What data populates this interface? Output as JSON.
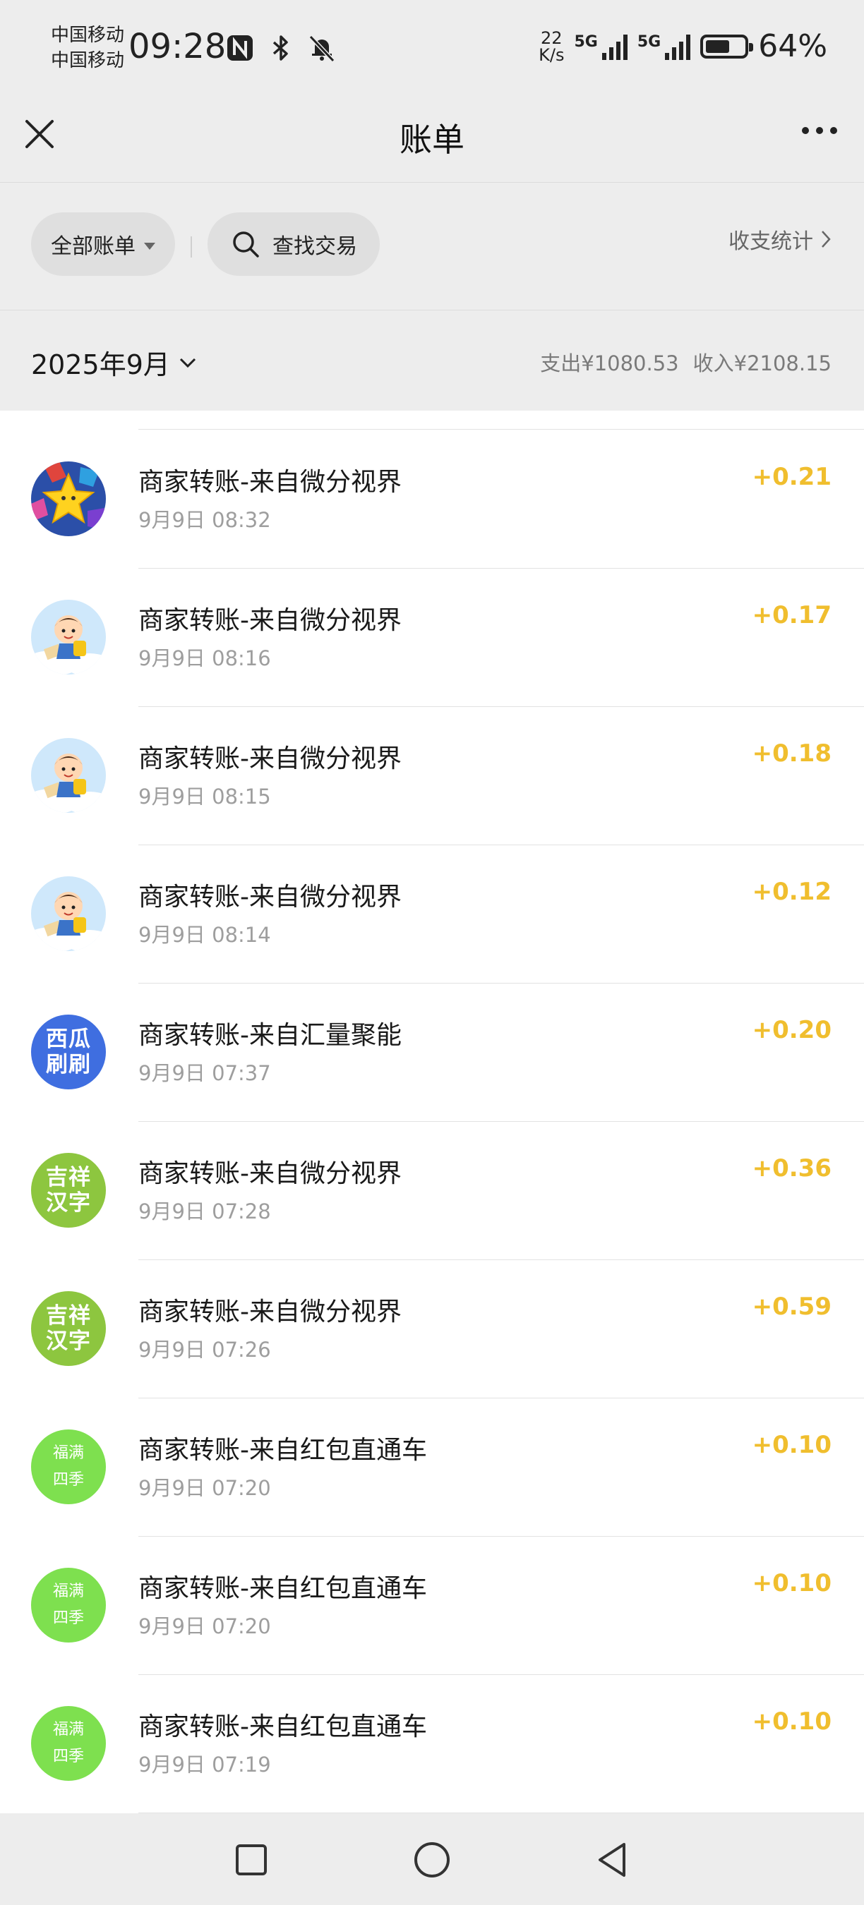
{
  "status_bar": {
    "carrier_1": "中国移动",
    "carrier_2": "中国移动",
    "time": "09:28",
    "net_speed_value": "22",
    "net_speed_unit": "K/s",
    "sim1_type": "5G",
    "sim2_type": "5G",
    "battery_percent": "64%",
    "battery_level": 0.64,
    "icons": [
      "nfc-icon",
      "bluetooth-icon",
      "bell-muted-icon"
    ]
  },
  "nav": {
    "title": "账单",
    "close_icon": "close-icon",
    "more_icon": "more-icon"
  },
  "filters": {
    "all_bills_label": "全部账单",
    "search_label": "查找交易",
    "stats_label": "收支统计"
  },
  "summary": {
    "month_label": "2025年9月",
    "expense": "支出¥1080.53",
    "income": "收入¥2108.15"
  },
  "transactions": [
    {
      "title": "商家转账-来自微分视界",
      "time": "9月9日 08:32",
      "amount": "+0.21",
      "avatar": "game-star"
    },
    {
      "title": "商家转账-来自微分视界",
      "time": "9月9日 08:16",
      "amount": "+0.17",
      "avatar": "cartoon-boy"
    },
    {
      "title": "商家转账-来自微分视界",
      "time": "9月9日 08:15",
      "amount": "+0.18",
      "avatar": "cartoon-boy"
    },
    {
      "title": "商家转账-来自微分视界",
      "time": "9月9日 08:14",
      "amount": "+0.12",
      "avatar": "cartoon-boy"
    },
    {
      "title": "商家转账-来自汇量聚能",
      "time": "9月9日 07:37",
      "amount": "+0.20",
      "avatar": "text",
      "avatar_line1": "西瓜",
      "avatar_line2": "刷刷",
      "avatar_bg": "#3f6ee0"
    },
    {
      "title": "商家转账-来自微分视界",
      "time": "9月9日 07:28",
      "amount": "+0.36",
      "avatar": "text",
      "avatar_line1": "吉祥",
      "avatar_line2": "汉字",
      "avatar_bg": "#8dc63f"
    },
    {
      "title": "商家转账-来自微分视界",
      "time": "9月9日 07:26",
      "amount": "+0.59",
      "avatar": "text",
      "avatar_line1": "吉祥",
      "avatar_line2": "汉字",
      "avatar_bg": "#8dc63f"
    },
    {
      "title": "商家转账-来自红包直通车",
      "time": "9月9日 07:20",
      "amount": "+0.10",
      "avatar": "text-small",
      "avatar_line1": "福满",
      "avatar_line2": "四季",
      "avatar_bg": "#7ee04f"
    },
    {
      "title": "商家转账-来自红包直通车",
      "time": "9月9日 07:20",
      "amount": "+0.10",
      "avatar": "text-small",
      "avatar_line1": "福满",
      "avatar_line2": "四季",
      "avatar_bg": "#7ee04f"
    },
    {
      "title": "商家转账-来自红包直通车",
      "time": "9月9日 07:19",
      "amount": "+0.10",
      "avatar": "text-small",
      "avatar_line1": "福满",
      "avatar_line2": "四季",
      "avatar_bg": "#7ee04f"
    }
  ],
  "colors": {
    "income_amount": "#f0be2e",
    "page_bg": "#ededed"
  },
  "system_nav": [
    "recent-apps-icon",
    "home-icon",
    "back-icon"
  ]
}
